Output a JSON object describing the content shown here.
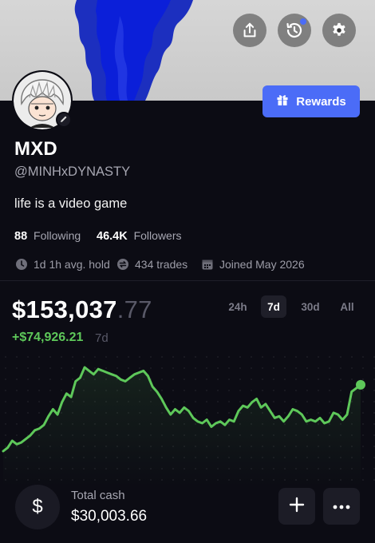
{
  "header": {
    "share_icon": "share-icon",
    "history_icon": "history-icon",
    "settings_icon": "gear-icon",
    "history_badge_color": "#4b6cf7"
  },
  "rewards_button": {
    "label": "Rewards",
    "icon": "gift-icon",
    "color": "#4b6cf7"
  },
  "profile": {
    "name": "MXD",
    "handle": "@MINHxDYNASTY",
    "bio": "life is a video game",
    "following_count": "88",
    "following_label": "Following",
    "followers_count": "46.4K",
    "followers_label": "Followers"
  },
  "stats": [
    {
      "icon": "clock-icon",
      "text": "1d 1h avg. hold"
    },
    {
      "icon": "trades-icon",
      "text": "434 trades"
    },
    {
      "icon": "calendar-icon",
      "text": "Joined May 2026"
    }
  ],
  "portfolio": {
    "balance_main": "$153,037",
    "balance_cents": ".77",
    "change": "+$74,926.21",
    "change_period": "7d",
    "positive_color": "#5ec85a"
  },
  "ranges": [
    {
      "label": "24h",
      "active": false
    },
    {
      "label": "7d",
      "active": true
    },
    {
      "label": "30d",
      "active": false
    },
    {
      "label": "All",
      "active": false
    }
  ],
  "chart_data": {
    "type": "line",
    "series": [
      {
        "values": [
          78,
          80,
          84,
          82,
          83,
          85,
          87,
          90,
          91,
          93,
          98,
          102,
          99,
          106,
          111,
          109,
          118,
          120,
          126,
          124,
          122,
          125,
          124,
          123,
          122,
          121,
          119,
          118,
          120,
          122,
          123,
          124,
          121,
          115,
          112,
          108,
          103,
          99,
          102,
          100,
          103,
          101,
          97,
          95,
          94,
          96,
          92,
          94,
          95,
          93,
          96,
          95,
          101,
          104,
          103,
          106,
          108,
          103,
          105,
          101,
          97,
          98,
          95,
          98,
          102,
          101,
          99,
          95,
          96,
          95,
          97,
          94,
          95,
          100,
          99,
          96,
          99,
          112,
          114,
          116
        ]
      }
    ]
  },
  "cash": {
    "label": "Total cash",
    "value": "$30,003.66",
    "symbol": "$"
  },
  "actions": {
    "add_icon": "plus-icon",
    "more_icon": "more-icon"
  }
}
